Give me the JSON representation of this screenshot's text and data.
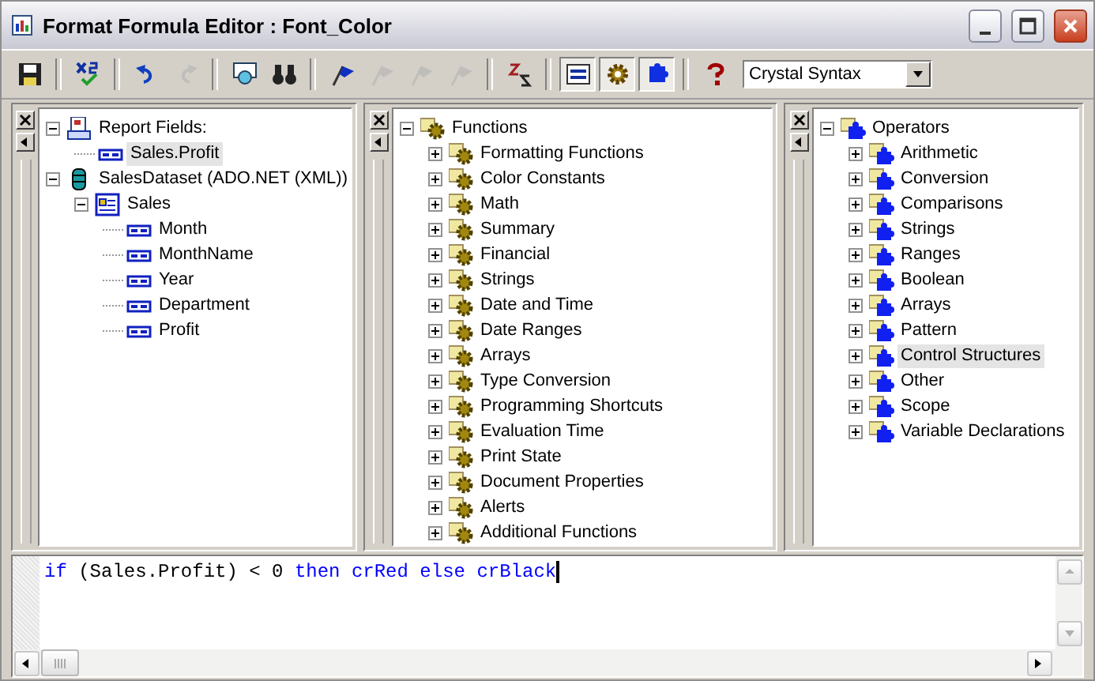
{
  "window": {
    "title": "Format Formula Editor : Font_Color"
  },
  "toolbar": {
    "buttons": [
      {
        "kind": "save",
        "disabled": false,
        "pressed": false
      },
      {
        "kind": "check",
        "disabled": false,
        "pressed": false
      },
      {
        "kind": "undo",
        "disabled": false,
        "pressed": false
      },
      {
        "kind": "redo",
        "disabled": true,
        "pressed": false
      },
      {
        "kind": "browse",
        "disabled": false,
        "pressed": false
      },
      {
        "kind": "find",
        "disabled": false,
        "pressed": false
      },
      {
        "kind": "bookmark",
        "disabled": false,
        "pressed": false
      },
      {
        "kind": "bookmark",
        "disabled": true,
        "pressed": false
      },
      {
        "kind": "bookmark",
        "disabled": true,
        "pressed": false
      },
      {
        "kind": "bookmark",
        "disabled": true,
        "pressed": false
      },
      {
        "kind": "sort",
        "disabled": false,
        "pressed": false
      },
      {
        "kind": "fields",
        "disabled": false,
        "pressed": true
      },
      {
        "kind": "functions",
        "disabled": false,
        "pressed": true
      },
      {
        "kind": "operators",
        "disabled": false,
        "pressed": true
      },
      {
        "kind": "help",
        "disabled": false,
        "pressed": false
      }
    ],
    "syntax": "Crystal Syntax"
  },
  "panels": [
    {
      "tree": [
        {
          "label": "Report Fields:",
          "kind": "report",
          "expanded": true,
          "selected": false,
          "children": [
            {
              "label": "Sales.Profit",
              "kind": "field",
              "selected": true
            }
          ]
        },
        {
          "label": "SalesDataset (ADO.NET (XML))",
          "kind": "dataset",
          "expanded": true,
          "selected": false,
          "children": [
            {
              "label": "Sales",
              "kind": "table",
              "expanded": true,
              "selected": false,
              "children": [
                {
                  "label": "Month",
                  "kind": "field",
                  "selected": false
                },
                {
                  "label": "MonthName",
                  "kind": "field",
                  "selected": false
                },
                {
                  "label": "Year",
                  "kind": "field",
                  "selected": false
                },
                {
                  "label": "Department",
                  "kind": "field",
                  "selected": false
                },
                {
                  "label": "Profit",
                  "kind": "field",
                  "selected": false
                }
              ]
            }
          ]
        }
      ]
    },
    {
      "tree": [
        {
          "label": "Functions",
          "kind": "function",
          "expanded": true,
          "selected": false,
          "children": [
            {
              "label": "Formatting Functions",
              "kind": "function",
              "expanded": false,
              "selected": false
            },
            {
              "label": "Color Constants",
              "kind": "function",
              "expanded": false,
              "selected": false
            },
            {
              "label": "Math",
              "kind": "function",
              "expanded": false,
              "selected": false
            },
            {
              "label": "Summary",
              "kind": "function",
              "expanded": false,
              "selected": false
            },
            {
              "label": "Financial",
              "kind": "function",
              "expanded": false,
              "selected": false
            },
            {
              "label": "Strings",
              "kind": "function",
              "expanded": false,
              "selected": false
            },
            {
              "label": "Date and Time",
              "kind": "function",
              "expanded": false,
              "selected": false
            },
            {
              "label": "Date Ranges",
              "kind": "function",
              "expanded": false,
              "selected": false
            },
            {
              "label": "Arrays",
              "kind": "function",
              "expanded": false,
              "selected": false
            },
            {
              "label": "Type Conversion",
              "kind": "function",
              "expanded": false,
              "selected": false
            },
            {
              "label": "Programming Shortcuts",
              "kind": "function",
              "expanded": false,
              "selected": false
            },
            {
              "label": "Evaluation Time",
              "kind": "function",
              "expanded": false,
              "selected": false
            },
            {
              "label": "Print State",
              "kind": "function",
              "expanded": false,
              "selected": false
            },
            {
              "label": "Document Properties",
              "kind": "function",
              "expanded": false,
              "selected": false
            },
            {
              "label": "Alerts",
              "kind": "function",
              "expanded": false,
              "selected": false
            },
            {
              "label": "Additional Functions",
              "kind": "function",
              "expanded": false,
              "selected": false
            }
          ]
        }
      ]
    },
    {
      "tree": [
        {
          "label": "Operators",
          "kind": "operator",
          "expanded": true,
          "selected": false,
          "children": [
            {
              "label": "Arithmetic",
              "kind": "operator",
              "expanded": false,
              "selected": false
            },
            {
              "label": "Conversion",
              "kind": "operator",
              "expanded": false,
              "selected": false
            },
            {
              "label": "Comparisons",
              "kind": "operator",
              "expanded": false,
              "selected": false
            },
            {
              "label": "Strings",
              "kind": "operator",
              "expanded": false,
              "selected": false
            },
            {
              "label": "Ranges",
              "kind": "operator",
              "expanded": false,
              "selected": false
            },
            {
              "label": "Boolean",
              "kind": "operator",
              "expanded": false,
              "selected": false
            },
            {
              "label": "Arrays",
              "kind": "operator",
              "expanded": false,
              "selected": false
            },
            {
              "label": "Pattern",
              "kind": "operator",
              "expanded": false,
              "selected": false
            },
            {
              "label": "Control Structures",
              "kind": "operator",
              "expanded": false,
              "selected": true
            },
            {
              "label": "Other",
              "kind": "operator",
              "expanded": false,
              "selected": false
            },
            {
              "label": "Scope",
              "kind": "operator",
              "expanded": false,
              "selected": false
            },
            {
              "label": "Variable Declarations",
              "kind": "operator",
              "expanded": false,
              "selected": false
            }
          ]
        }
      ]
    }
  ],
  "editor": {
    "tokens": [
      {
        "text": "if",
        "kind": "keyword"
      },
      {
        "text": "(Sales.Profit) < 0",
        "kind": "plain"
      },
      {
        "text": "then",
        "kind": "keyword"
      },
      {
        "text": "crRed",
        "kind": "keyword"
      },
      {
        "text": "else",
        "kind": "keyword"
      },
      {
        "text": "crBlack",
        "kind": "keyword"
      }
    ]
  }
}
